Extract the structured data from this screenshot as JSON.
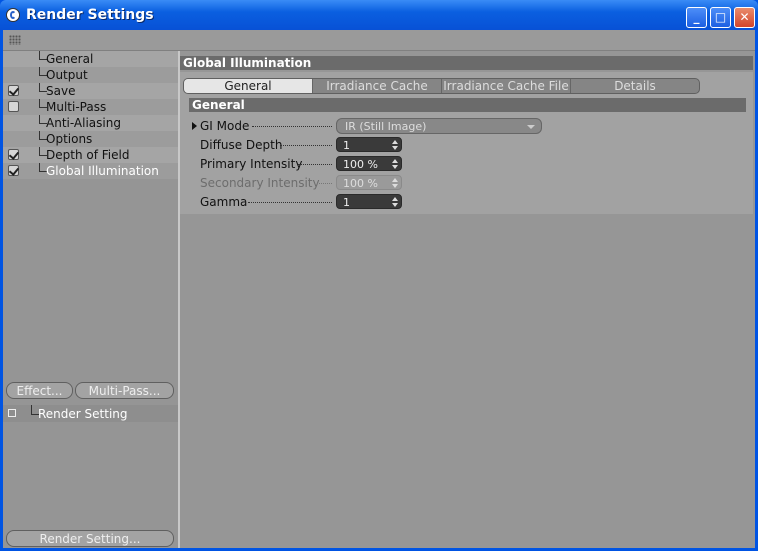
{
  "window": {
    "title": "Render Settings"
  },
  "tree": {
    "items": [
      {
        "label": "General",
        "checkbox": false,
        "checked": false
      },
      {
        "label": "Output",
        "checkbox": false,
        "checked": false
      },
      {
        "label": "Save",
        "checkbox": true,
        "checked": true
      },
      {
        "label": "Multi-Pass",
        "checkbox": true,
        "checked": false
      },
      {
        "label": "Anti-Aliasing",
        "checkbox": false,
        "checked": false
      },
      {
        "label": "Options",
        "checkbox": false,
        "checked": false
      },
      {
        "label": "Depth of Field",
        "checkbox": true,
        "checked": true
      },
      {
        "label": "Global Illumination",
        "checkbox": true,
        "checked": true,
        "selected": true
      }
    ]
  },
  "buttons": {
    "effect": "Effect...",
    "multipass": "Multi-Pass...",
    "render_setting": "Render Setting..."
  },
  "render_settings_list": {
    "item": "Render Setting"
  },
  "panel": {
    "title": "Global Illumination",
    "tabs": [
      {
        "label": "General",
        "active": true
      },
      {
        "label": "Irradiance Cache",
        "active": false
      },
      {
        "label": "Irradiance Cache File",
        "active": false
      },
      {
        "label": "Details",
        "active": false
      }
    ],
    "section": "General",
    "fields": {
      "gi_mode": {
        "label": "GI Mode",
        "value": "IR (Still Image)"
      },
      "diffuse_depth": {
        "label": "Diffuse Depth",
        "value": "1"
      },
      "primary_intensity": {
        "label": "Primary Intensity",
        "value": "100 %"
      },
      "secondary_intensity": {
        "label": "Secondary Intensity",
        "value": "100 %",
        "disabled": true
      },
      "gamma": {
        "label": "Gamma",
        "value": "1"
      }
    }
  }
}
